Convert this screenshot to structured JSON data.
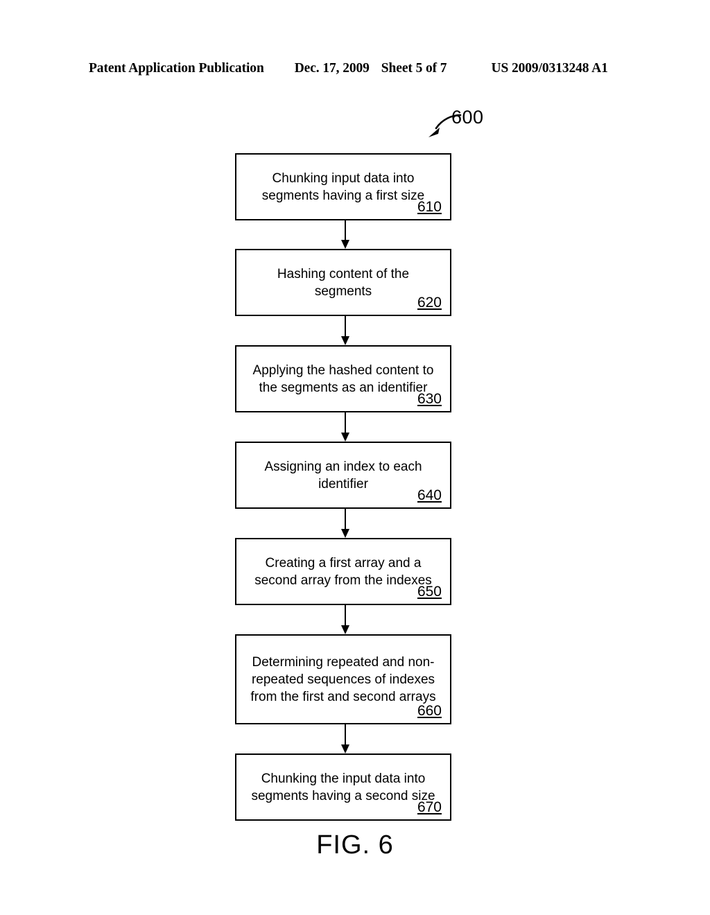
{
  "header": {
    "publication": "Patent Application Publication",
    "date": "Dec. 17, 2009",
    "sheet": "Sheet 5 of 7",
    "patent_number": "US 2009/0313248 A1"
  },
  "figure": {
    "reference_label": "600",
    "caption": "FIG. 6"
  },
  "flowchart": {
    "nodes": [
      {
        "text": "Chunking input data into\nsegments having a first size",
        "number": "610"
      },
      {
        "text": "Hashing content of the\nsegments",
        "number": "620"
      },
      {
        "text": "Applying the hashed content to\nthe segments as an identifier",
        "number": "630"
      },
      {
        "text": "Assigning an index to each\nidentifier",
        "number": "640"
      },
      {
        "text": "Creating a first array and a\nsecond array from the indexes",
        "number": "650"
      },
      {
        "text": "Determining repeated and non-\nrepeated sequences of indexes\nfrom the first and second arrays",
        "number": "660"
      },
      {
        "text": "Chunking the input data into\nsegments having a second size",
        "number": "670"
      }
    ]
  }
}
